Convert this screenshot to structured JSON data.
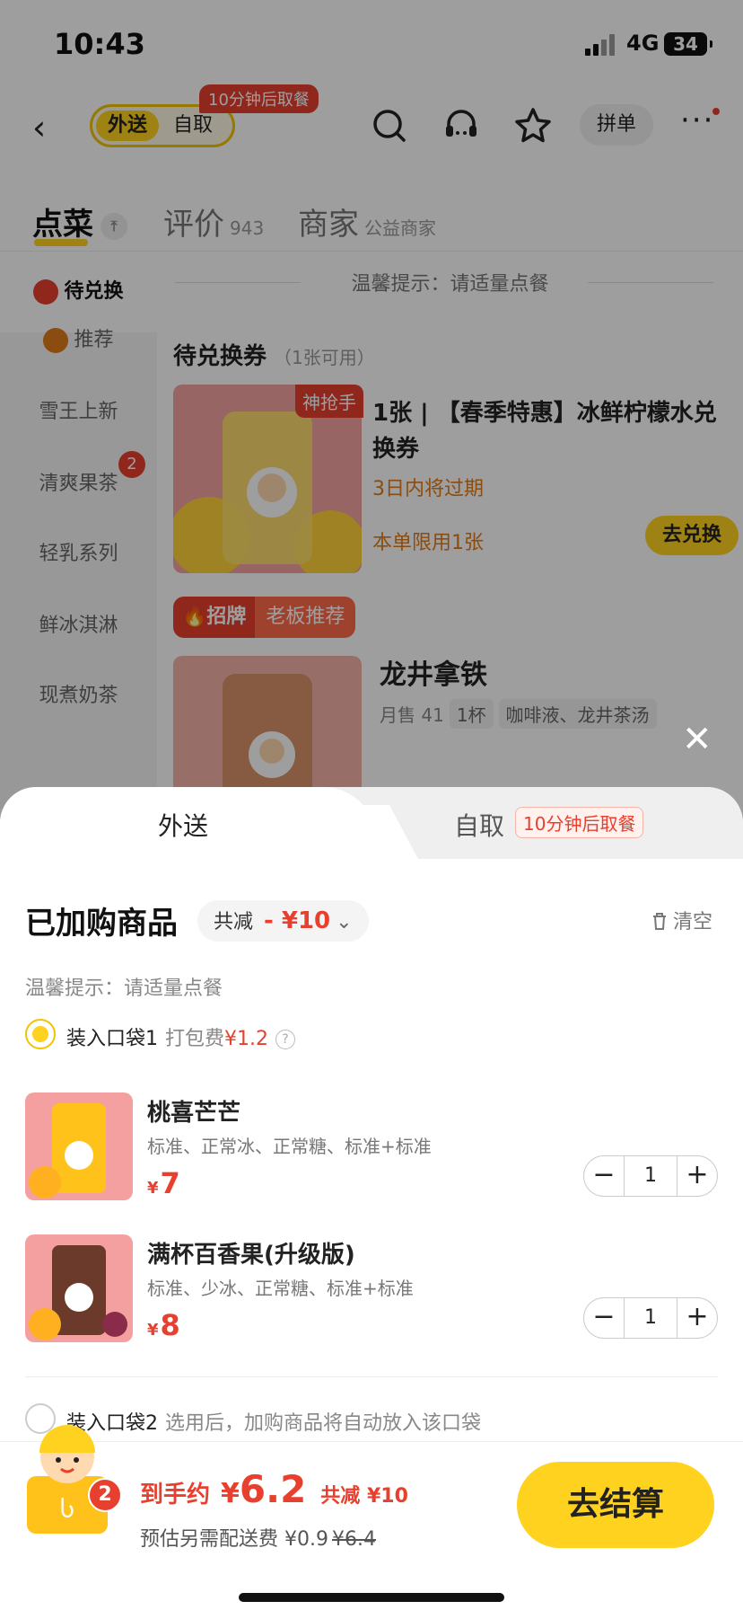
{
  "status_bar": {
    "time": "10:43",
    "network": "4G",
    "battery": "34"
  },
  "navbar": {
    "mode_delivery": "外送",
    "mode_pickup": "自取",
    "pickup_tag": "10分钟后取餐",
    "group_order": "拼单"
  },
  "tabs": {
    "menu": "点菜",
    "reviews": "评价",
    "reviews_count": "943",
    "merchant": "商家",
    "merchant_note": "公益商家"
  },
  "sidebar": {
    "items": [
      {
        "label": "待兑换"
      },
      {
        "label": "推荐"
      },
      {
        "label": "雪王上新"
      },
      {
        "label": "清爽果茶",
        "badge": "2"
      },
      {
        "label": "轻乳系列"
      },
      {
        "label": "鲜冰淇淋"
      },
      {
        "label": "现煮奶茶"
      }
    ]
  },
  "menu": {
    "tip": "温馨提示：请适量点餐",
    "coupon_section": "待兑换券",
    "coupon_section_note": "（1张可用）",
    "coupon": {
      "flag": "神抢手",
      "title": "1张 | 【春季特惠】冰鲜柠檬水兑换券",
      "expire": "3日内将过期",
      "limit": "本单限用1张",
      "redeem": "去兑换"
    },
    "signature_tag": "招牌",
    "signature_sub": "老板推荐",
    "product": {
      "name": "龙井拿铁",
      "monthly_sales": "月售 41",
      "chip_cup": "1杯",
      "chip_ingredients": "咖啡液、龙井茶汤"
    }
  },
  "sheet": {
    "tab_delivery": "外送",
    "tab_pickup": "自取",
    "tab_pickup_tag": "10分钟后取餐",
    "title": "已加购商品",
    "discount_label": "共减",
    "discount_value": "- ¥10",
    "clear": "清空",
    "tip": "温馨提示：请适量点餐",
    "bag1_label": "装入口袋1",
    "bag1_fee_label": "打包费",
    "bag1_fee": "¥1.2",
    "items": [
      {
        "name": "桃喜芒芒",
        "spec": "标准、正常冰、正常糖、标准+标准",
        "currency": "¥",
        "price": "7",
        "qty": "1"
      },
      {
        "name": "满杯百香果(升级版)",
        "spec": "标准、少冰、正常糖、标准+标准",
        "currency": "¥",
        "price": "8",
        "qty": "1"
      }
    ],
    "bag2_label": "装入口袋2",
    "bag2_note": "选用后，加购商品将自动放入该口袋"
  },
  "checkout": {
    "cart_count": "2",
    "total_label": "到手约",
    "currency": "¥",
    "total": "6.2",
    "saved": "共减 ¥10",
    "fee_label": "预估另需配送费",
    "fee": "¥0.9",
    "fee_original": "¥6.4",
    "button": "去结算"
  },
  "colors": {
    "brand_yellow": "#ffd21f",
    "price_red": "#e8402f",
    "warn_orange": "#e07b1a"
  },
  "icons": [
    "back-icon",
    "search-icon",
    "customer-service-icon",
    "star-icon",
    "more-icon",
    "close-icon",
    "trash-icon",
    "question-icon",
    "chevron-down-icon",
    "minus-icon",
    "plus-icon",
    "flame-icon"
  ]
}
